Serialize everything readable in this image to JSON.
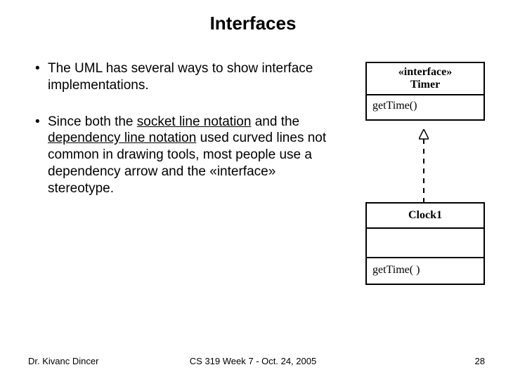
{
  "title": "Interfaces",
  "bullets": [
    {
      "parts": [
        {
          "text": "The UML has several ways to show interface implementations."
        }
      ]
    },
    {
      "parts": [
        {
          "text": "Since both the "
        },
        {
          "text": "socket line notation",
          "underline": true
        },
        {
          "text": " and the "
        },
        {
          "text": "dependency line notation",
          "underline": true
        },
        {
          "text": " used curved lines not common in drawing tools, most people use a dependency arrow and the «interface» stereotype."
        }
      ]
    }
  ],
  "uml": {
    "interface": {
      "stereotype": "«interface»",
      "name": "Timer",
      "operation": "getTime()"
    },
    "class": {
      "name": "Clock1",
      "operation": "getTime( )"
    }
  },
  "footer": {
    "left": "Dr. Kivanc Dincer",
    "center": "CS 319 Week 7 - Oct. 24, 2005",
    "right": "28"
  }
}
